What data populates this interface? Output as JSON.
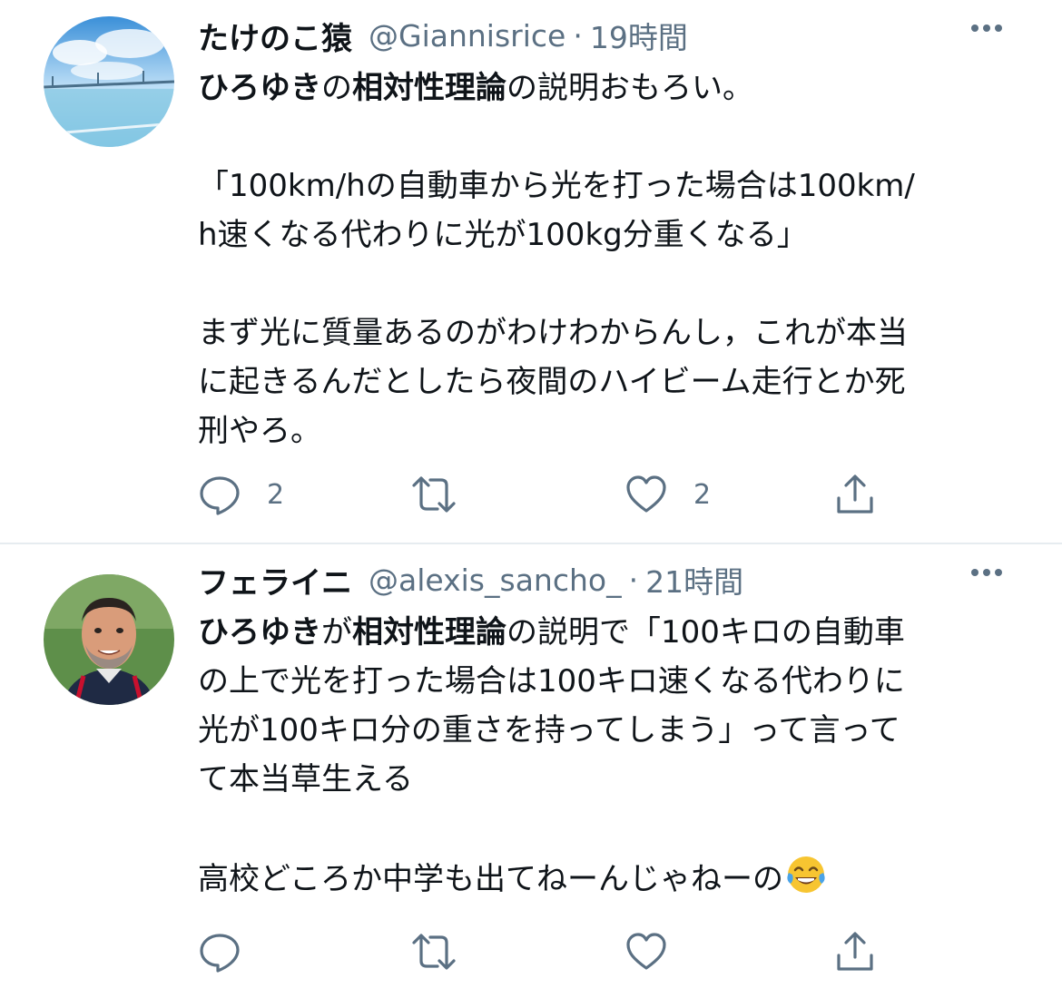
{
  "tweets": [
    {
      "display_name": "たけのこ猿",
      "handle": "@Giannisrice",
      "time": "19時間",
      "body_segments": [
        {
          "text": "ひろゆき",
          "bold": true
        },
        {
          "text": "の",
          "bold": false
        },
        {
          "text": "相対性理論",
          "bold": true
        },
        {
          "text": "の説明おもろい。\n\n「100km/hの自動車から光を打った場合は100km/\nh速くなる代わりに光が100kg分重くなる」\n\nまず光に質量あるのがわけわからんし，これが本当\nに起きるんだとしたら夜間のハイビーム走行とか死\n刑やろ。",
          "bold": false
        }
      ],
      "reply_count": "2",
      "retweet_count": "",
      "like_count": "2"
    },
    {
      "display_name": "フェライニ",
      "handle": "@alexis_sancho_",
      "time": "21時間",
      "body_segments": [
        {
          "text": "ひろゆき",
          "bold": true
        },
        {
          "text": "が",
          "bold": false
        },
        {
          "text": "相対性理論",
          "bold": true
        },
        {
          "text": "の説明で「100キロの自動車\nの上で光を打った場合は100キロ速くなる代わりに\n光が100キロ分の重さを持ってしまう」って言って\nて本当草生える\n\n高校どころか中学も出てねーんじゃねーの",
          "bold": false
        }
      ],
      "emoji": "face-with-tears-of-joy",
      "reply_count": "",
      "retweet_count": "",
      "like_count": ""
    }
  ],
  "separator": "·",
  "colors": {
    "text": "#0f1419",
    "secondary": "#5b7083",
    "divider": "#e6ecf0"
  },
  "icons": [
    "reply-icon",
    "retweet-icon",
    "like-icon",
    "share-icon",
    "more-icon"
  ]
}
